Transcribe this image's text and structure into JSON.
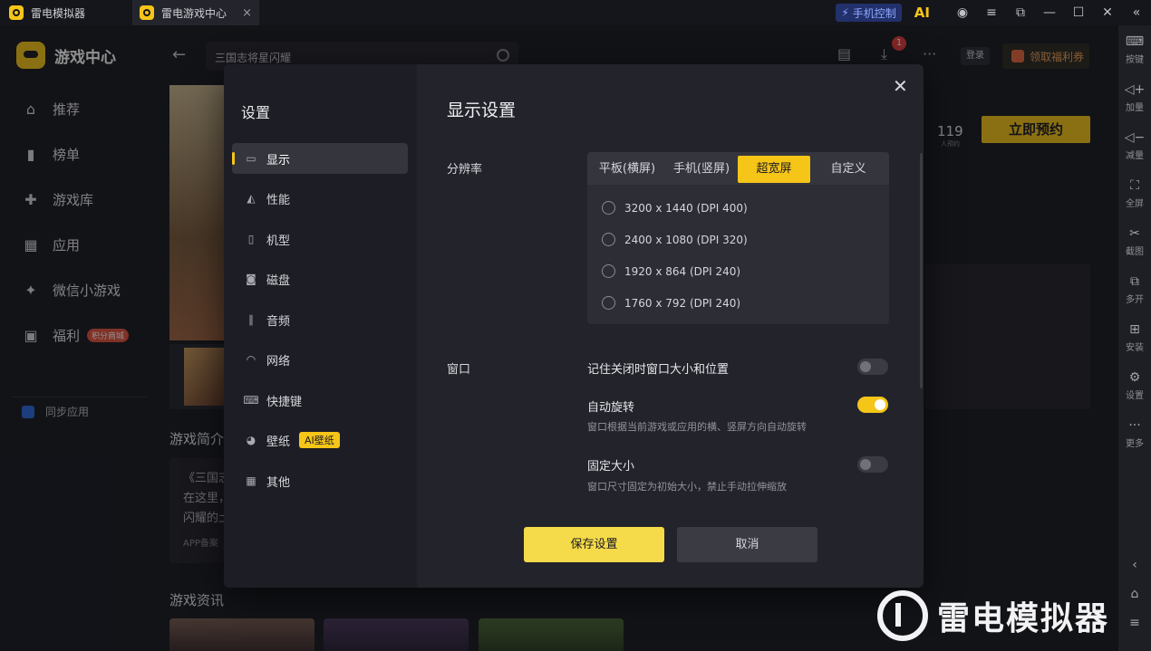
{
  "titlebar": {
    "tabs": [
      {
        "label": "雷电模拟器"
      },
      {
        "label": "雷电游戏中心",
        "close": "×"
      }
    ],
    "phone_control": "手机控制",
    "ai": "AI"
  },
  "app": {
    "brand": "游戏中心",
    "nav": [
      {
        "label": "推荐"
      },
      {
        "label": "榜单"
      },
      {
        "label": "游戏库"
      },
      {
        "label": "应用"
      },
      {
        "label": "微信小游戏"
      },
      {
        "label": "福利",
        "badge": "积分商城"
      }
    ],
    "sync": "同步应用"
  },
  "topbar": {
    "search_value": "三国志将星闪耀",
    "download_count": "1",
    "login": "登录",
    "welfare": "领取福利券"
  },
  "page": {
    "stat_value": "119",
    "stat_label": "人预约",
    "preorder": "立即预约",
    "intro_heading": "游戏简介",
    "intro_lines": [
      "《三国志",
      "在这里，",
      "闪耀的土"
    ],
    "app_record": "APP备案",
    "news_heading": "游戏资讯"
  },
  "right_toolbar": [
    {
      "label": "按键"
    },
    {
      "label": "加量"
    },
    {
      "label": "减量"
    },
    {
      "label": "全屏"
    },
    {
      "label": "截图"
    },
    {
      "label": "多开"
    },
    {
      "label": "安装"
    },
    {
      "label": "设置"
    },
    {
      "label": "更多"
    }
  ],
  "dialog": {
    "title": "设置",
    "heading": "显示设置",
    "nav": [
      {
        "label": "显示"
      },
      {
        "label": "性能"
      },
      {
        "label": "机型"
      },
      {
        "label": "磁盘"
      },
      {
        "label": "音频"
      },
      {
        "label": "网络"
      },
      {
        "label": "快捷键"
      },
      {
        "label": "壁纸",
        "tag": "AI壁纸"
      },
      {
        "label": "其他"
      }
    ],
    "resolution_label": "分辨率",
    "segments": [
      {
        "label": "平板(横屏)"
      },
      {
        "label": "手机(竖屏)"
      },
      {
        "label": "超宽屏"
      },
      {
        "label": "自定义"
      }
    ],
    "resolutions": [
      {
        "label": "3200 x 1440  (DPI 400)"
      },
      {
        "label": "2400 x 1080  (DPI 320)"
      },
      {
        "label": "1920 x 864  (DPI 240)"
      },
      {
        "label": "1760 x 792  (DPI 240)"
      }
    ],
    "window_label": "窗口",
    "options": [
      {
        "title": "记住关闭时窗口大小和位置",
        "desc": "",
        "on": false
      },
      {
        "title": "自动旋转",
        "desc": "窗口根据当前游戏或应用的横、竖屏方向自动旋转",
        "on": true
      },
      {
        "title": "固定大小",
        "desc": "窗口尺寸固定为初始大小，禁止手动拉伸缩放",
        "on": false
      }
    ],
    "save": "保存设置",
    "cancel": "取消"
  },
  "watermark": "雷电模拟器",
  "colors": {
    "accent": "#f5c518",
    "bg": "#1b1c22",
    "dialog": "#23242b"
  }
}
